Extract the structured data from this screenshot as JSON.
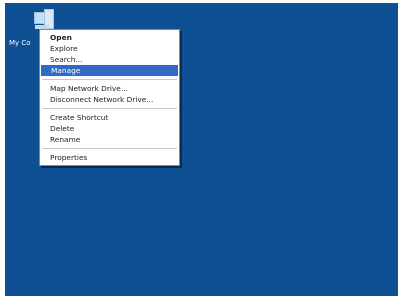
{
  "desktop": {
    "icon": {
      "label": "My Co",
      "icon_name": "my-computer-icon"
    }
  },
  "context_menu": {
    "items": [
      {
        "label": "Open",
        "default": true
      },
      {
        "label": "Explore"
      },
      {
        "label": "Search..."
      },
      {
        "label": "Manage",
        "selected": true
      },
      {
        "label": "Map Network Drive..."
      },
      {
        "label": "Disconnect Network Drive..."
      },
      {
        "label": "Create Shortcut"
      },
      {
        "label": "Delete"
      },
      {
        "label": "Rename"
      },
      {
        "label": "Properties"
      }
    ]
  },
  "colors": {
    "desktop_bg": "#0f4f93",
    "selection": "#316ac5"
  }
}
